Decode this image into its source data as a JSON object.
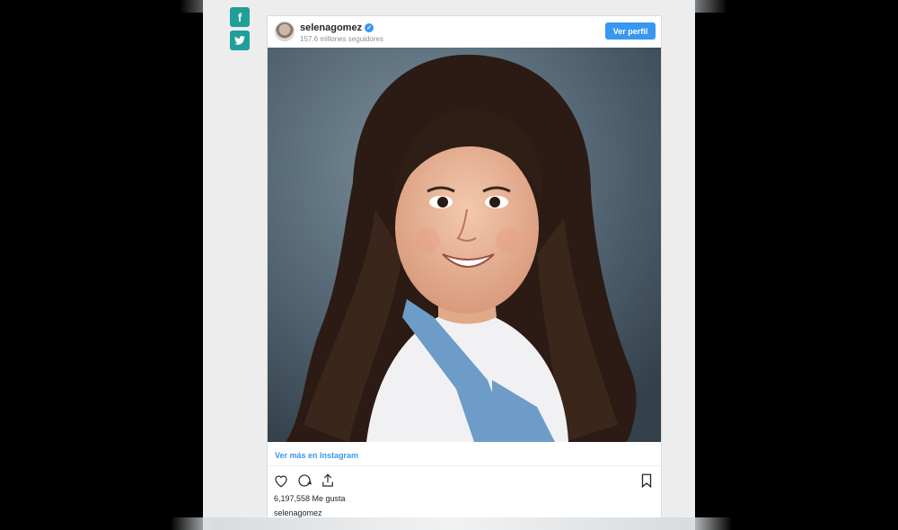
{
  "share": {
    "facebook_icon": "facebook-icon",
    "twitter_icon": "twitter-icon",
    "facebook_glyph": "f",
    "twitter_glyph": "🐦"
  },
  "post": {
    "username": "selenagomez",
    "followers": "157.6 millones seguidores",
    "view_profile_label": "Ver perfil",
    "view_more_label": "Ver más en Instagram",
    "likes": "6,197,558 Me gusta",
    "caption_username": "selenagomez",
    "verified_glyph": "✓"
  },
  "colors": {
    "accent": "#3897f0",
    "share_teal": "#1f9e9a"
  }
}
